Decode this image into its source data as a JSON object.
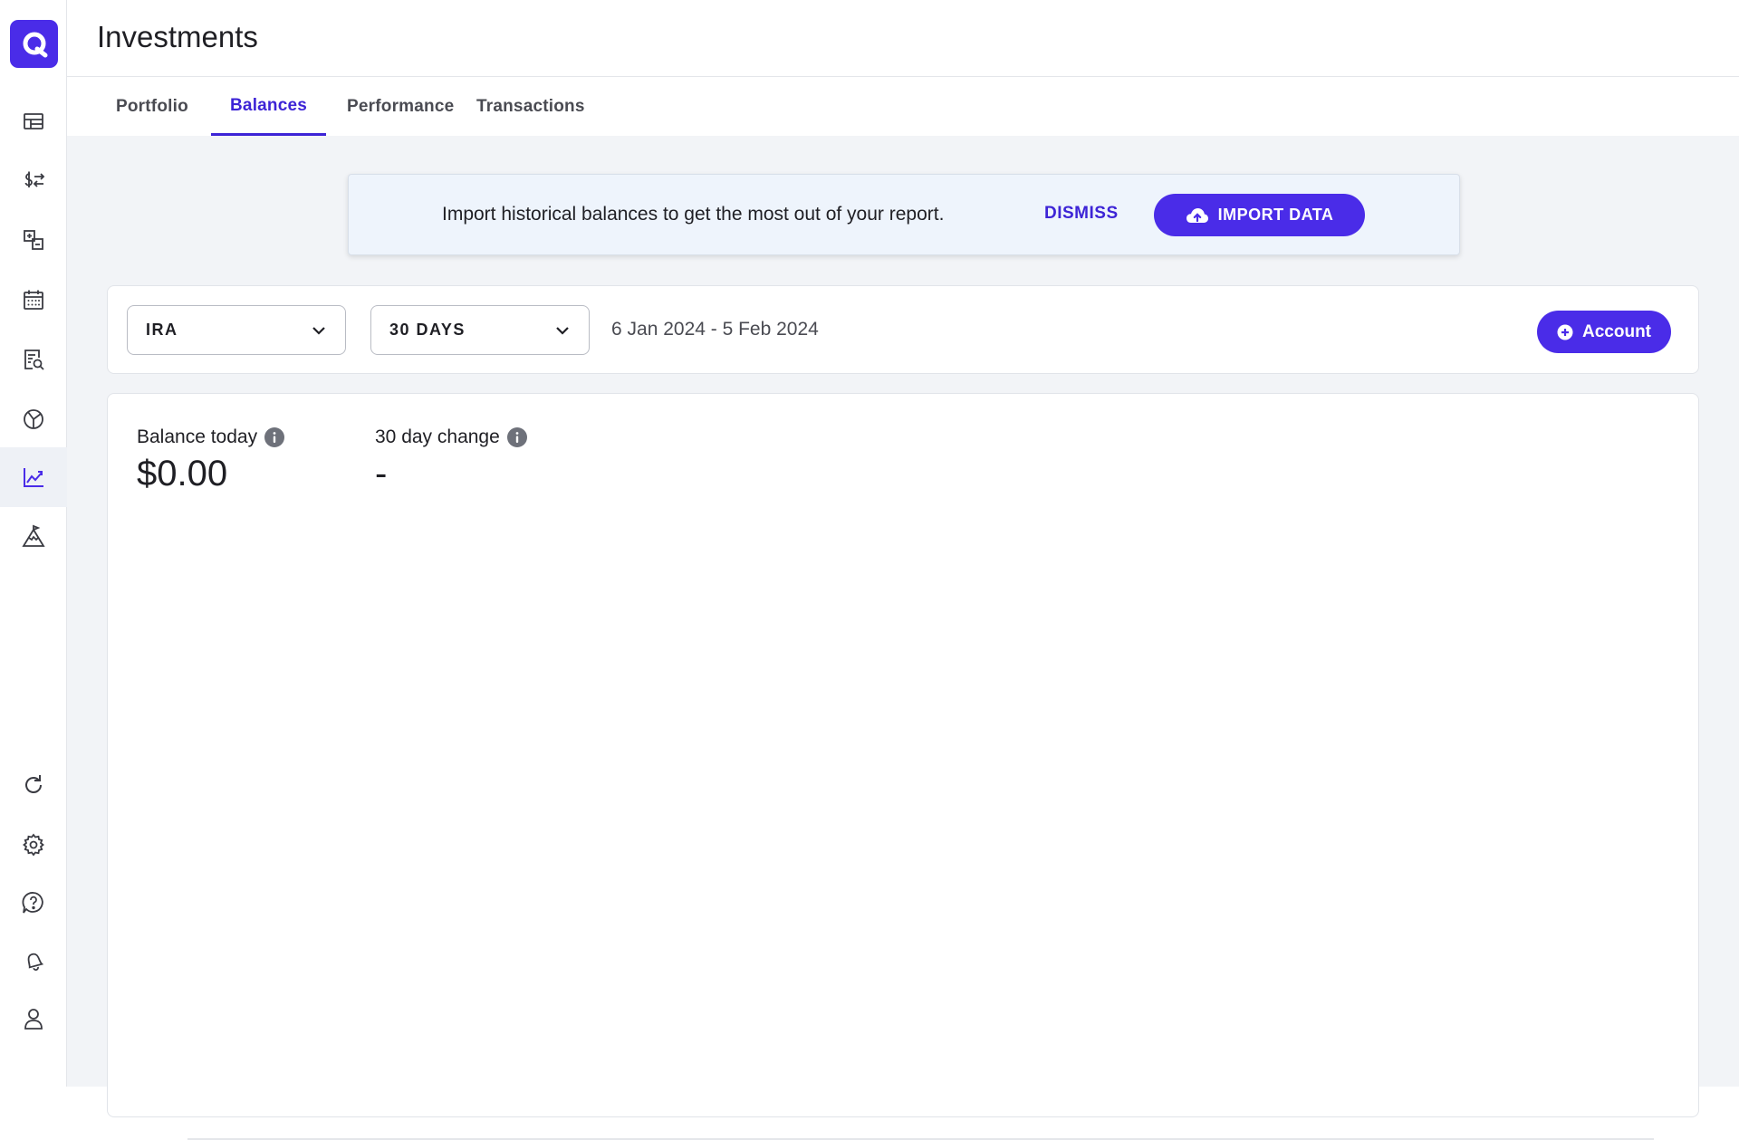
{
  "app": {
    "title": "Investments",
    "accent_color": "#4a2ce8",
    "logo_icon": "quicken-logo-icon"
  },
  "sidebar": {
    "items": [
      {
        "name": "dashboard-icon",
        "active": false
      },
      {
        "name": "transactions-icon",
        "active": false
      },
      {
        "name": "categories-icon",
        "active": false
      },
      {
        "name": "calendar-icon",
        "active": false
      },
      {
        "name": "reports-icon",
        "active": false
      },
      {
        "name": "spending-pie-icon",
        "active": false
      },
      {
        "name": "investments-icon",
        "active": true
      },
      {
        "name": "planning-icon",
        "active": false
      }
    ],
    "bottom_items": [
      {
        "name": "refresh-icon"
      },
      {
        "name": "settings-icon"
      },
      {
        "name": "help-icon"
      },
      {
        "name": "notifications-icon"
      },
      {
        "name": "profile-icon"
      }
    ]
  },
  "tabs": [
    {
      "label": "Portfolio",
      "active": false
    },
    {
      "label": "Balances",
      "active": true
    },
    {
      "label": "Performance",
      "active": false
    },
    {
      "label": "Transactions",
      "active": false
    }
  ],
  "banner": {
    "message": "Import historical balances to get the most out of your report.",
    "dismiss_label": "DISMISS",
    "import_label": "IMPORT DATA"
  },
  "filters": {
    "account_select": "IRA",
    "period_select": "30 DAYS",
    "date_range": "6 Jan 2024 - 5 Feb 2024",
    "add_account_label": "Account"
  },
  "stats": {
    "balance_today_label": "Balance today",
    "balance_today_value": "$0.00",
    "change_label": "30 day change",
    "change_value": "-"
  }
}
